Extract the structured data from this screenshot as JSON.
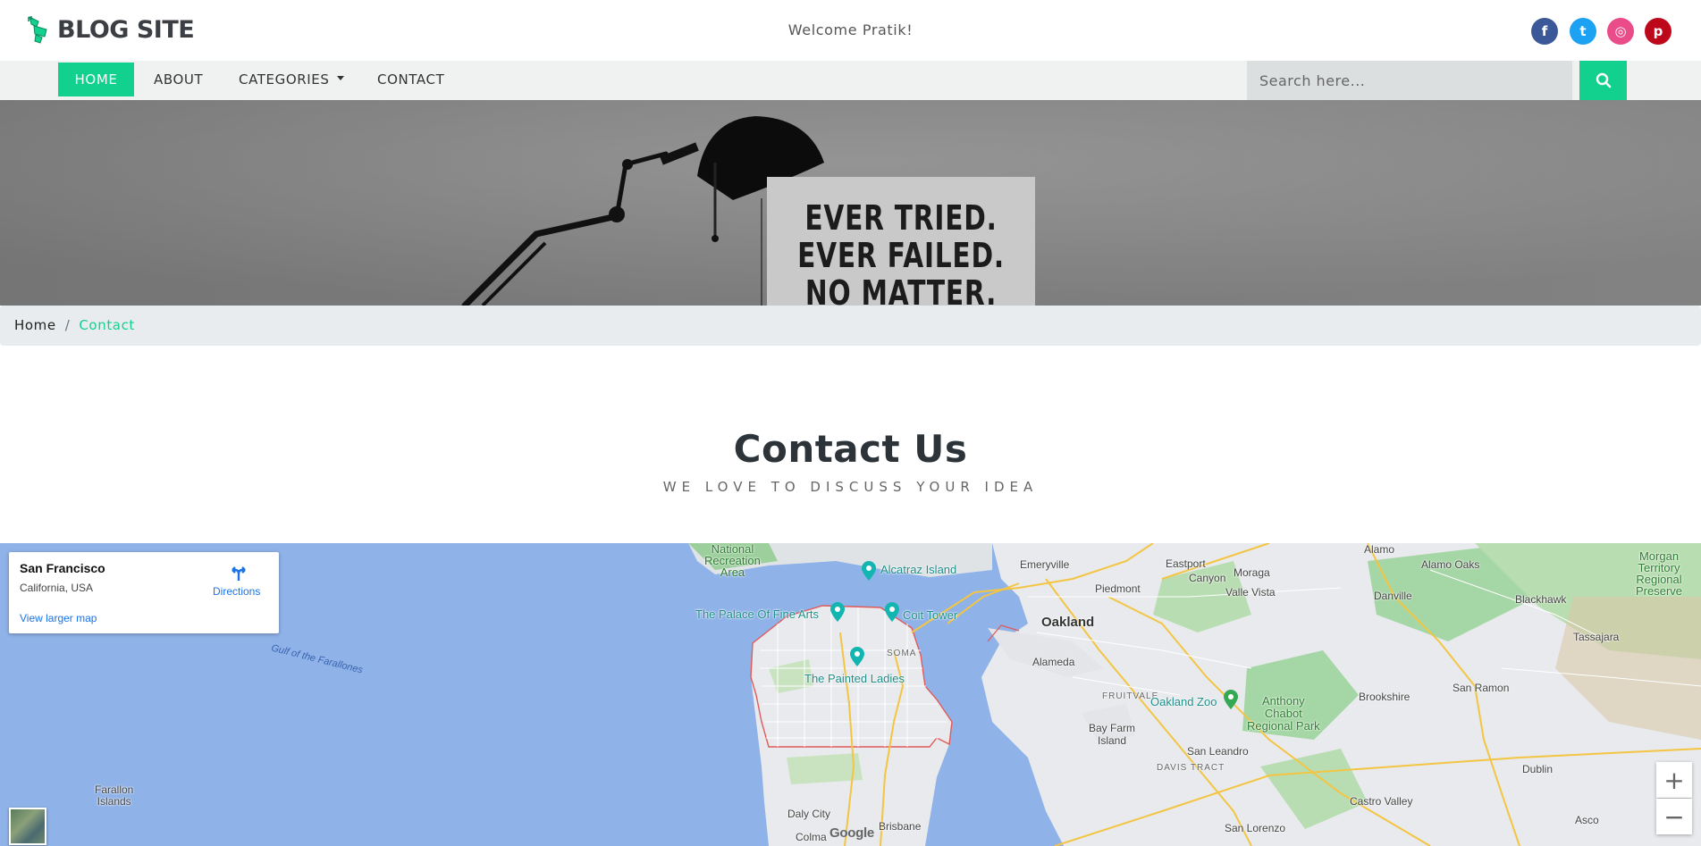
{
  "brand": {
    "name": "BLOG SITE",
    "accent": "#12d18e"
  },
  "header": {
    "welcome": "Welcome Pratik!"
  },
  "social": [
    {
      "name": "facebook",
      "glyph": "f",
      "color": "#3b5998"
    },
    {
      "name": "twitter",
      "glyph": "t",
      "color": "#1da1f2"
    },
    {
      "name": "dribbble",
      "glyph": "◎",
      "color": "#ea4c89"
    },
    {
      "name": "pinterest",
      "glyph": "p",
      "color": "#bd081c"
    }
  ],
  "nav": {
    "items": [
      {
        "label": "HOME",
        "active": true
      },
      {
        "label": "ABOUT",
        "active": false
      },
      {
        "label": "CATEGORIES",
        "active": false,
        "dropdown": true
      },
      {
        "label": "CONTACT",
        "active": false
      }
    ],
    "search_placeholder": "Search here..."
  },
  "hero": {
    "lines": [
      "EVER TRIED.",
      "EVER FAILED.",
      "NO MATTER."
    ]
  },
  "breadcrumb": {
    "home": "Home",
    "separator": "/",
    "current": "Contact"
  },
  "contact": {
    "title": "Contact Us",
    "subtitle": "WE LOVE TO DISCUSS YOUR IDEA"
  },
  "map": {
    "place_title": "San Francisco",
    "place_subtitle": "California, USA",
    "larger_map_link": "View larger map",
    "directions_label": "Directions",
    "zoom_in": "+",
    "zoom_out": "−",
    "attribution": "Google",
    "labels": {
      "national_rec": "National\nRecreation\nArea",
      "alcatraz": "Alcatraz Island",
      "emeryville": "Emeryville",
      "eastport": "Eastport",
      "alamo": "Alamo",
      "alamo_oaks": "Alamo Oaks",
      "morgan": "Morgan\nTerritory\nRegional\nPreserve",
      "palace": "The Palace Of Fine Arts",
      "coit": "Coit Tower",
      "oakland": "Oakland",
      "piedmont": "Piedmont",
      "moraga": "Moraga",
      "canyon": "Canyon",
      "valle_vista": "Valle Vista",
      "danville": "Danville",
      "blackhawk": "Blackhawk",
      "tassajara": "Tassajara",
      "gulf": "Gulf of the Farallones",
      "soma": "SOMA",
      "painted_ladies": "The Painted Ladies",
      "alameda": "Alameda",
      "fruitvale": "FRUITVALE",
      "oakland_zoo": "Oakland Zoo",
      "anthony_chabot": "Anthony\nChabot\nRegional Park",
      "brookshire": "Brookshire",
      "san_ramon": "San Ramon",
      "bay_farm": "Bay Farm\nIsland",
      "san_leandro": "San Leandro",
      "davis_tract": "DAVIS TRACT",
      "dublin": "Dublin",
      "farallon": "Farallon\nIslands",
      "daly_city": "Daly City",
      "brisbane": "Brisbane",
      "colma": "Colma",
      "castro_valley": "Castro Valley",
      "san_lorenzo": "San Lorenzo",
      "asco": "Asco"
    },
    "colors": {
      "water": "#8fb2e8",
      "land": "#e8eaed",
      "park": "#9ccf9c",
      "road": "#f4c542"
    }
  }
}
